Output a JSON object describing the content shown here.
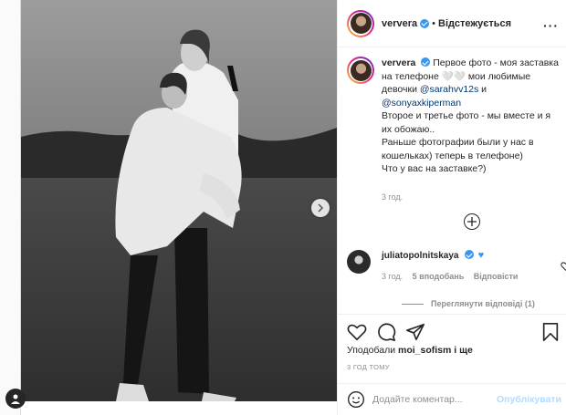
{
  "post": {
    "username": "ververa",
    "follow_status": "Відстежується",
    "separator": "•",
    "more_icon": "more-horizontal-icon"
  },
  "caption": {
    "username": "ververa",
    "line1": "Первое фото - моя заставка на телефоне",
    "emoji": "🤍🤍",
    "line1b": " мои любимые девочки ",
    "mention1": "@sarahvv12s",
    "and": " и ",
    "mention2": "@sonyaxkiperman",
    "line2": "Второе и третье фото - мы вместе и я их обожаю..",
    "line3": "Раньше фотографии были у нас в кошельках) теперь в телефоне)",
    "line4": "Что у вас на заставке?)",
    "time": "3 год."
  },
  "comment": {
    "username": "juliatopolnitskaya",
    "time": "3 год.",
    "likes": "5 вподобань",
    "reply": "Відповісти",
    "view_replies": "Переглянути відповіді (1)"
  },
  "likes": {
    "prefix": "Уподобали",
    "user": "moi_sofism",
    "suffix": "і ще"
  },
  "post_time": "3 ГОД ТОМУ",
  "comment_input": {
    "placeholder": "Додайте коментар..."
  },
  "publish_label": "Опублікувати",
  "colors": {
    "accent": "#3897f0",
    "publish_disabled": "#b3dbff",
    "mention": "#00376b"
  }
}
